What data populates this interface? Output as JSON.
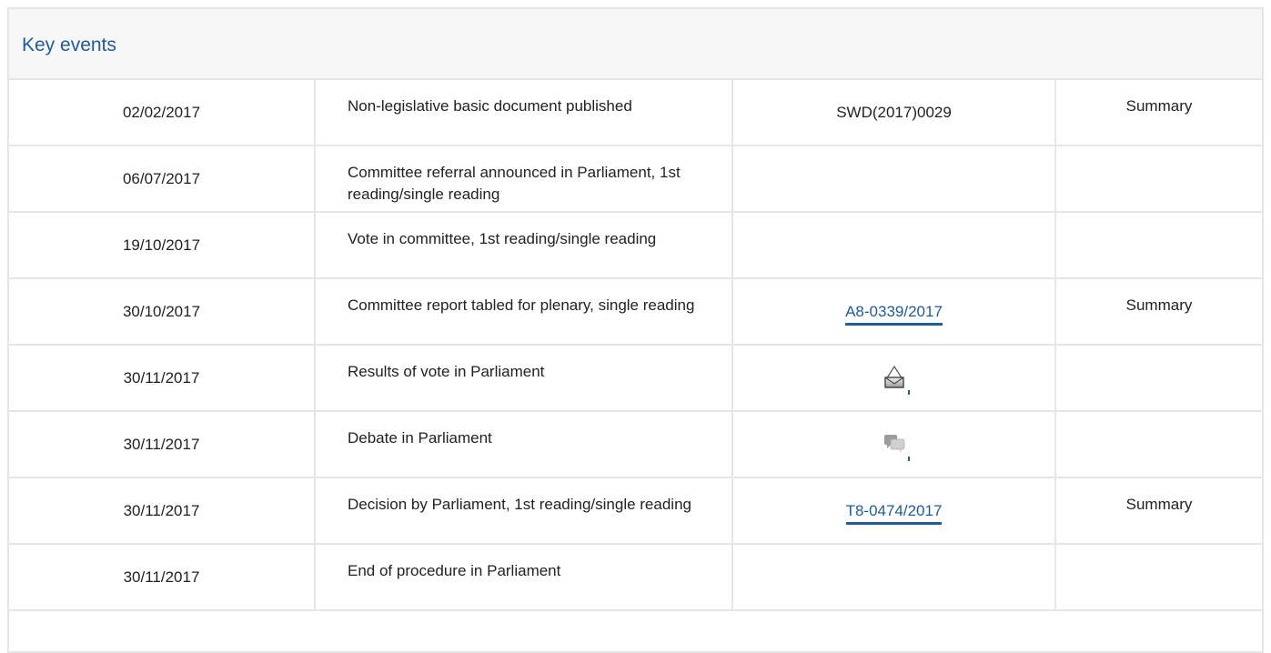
{
  "header": {
    "title": "Key events"
  },
  "rows": [
    {
      "date": "02/02/2017",
      "event": "Non-legislative basic document published",
      "doc": "SWD(2017)0029",
      "summary": "Summary"
    },
    {
      "date": "06/07/2017",
      "event": "Committee referral announced in Parliament, 1st reading/single reading",
      "doc": "",
      "summary": ""
    },
    {
      "date": "19/10/2017",
      "event": "Vote in committee, 1st reading/single reading",
      "doc": "",
      "summary": ""
    },
    {
      "date": "30/10/2017",
      "event": "Committee report tabled for plenary, single reading",
      "doc": "A8-0339/2017",
      "summary": "Summary"
    },
    {
      "date": "30/11/2017",
      "event": "Results of vote in Parliament",
      "doc_icon": "ballot-box-icon",
      "summary": ""
    },
    {
      "date": "30/11/2017",
      "event": "Debate in Parliament",
      "doc_icon": "speech-bubbles-icon",
      "summary": ""
    },
    {
      "date": "30/11/2017",
      "event": "Decision by Parliament, 1st reading/single reading",
      "doc": "T8-0474/2017",
      "summary": "Summary"
    },
    {
      "date": "30/11/2017",
      "event": "End of procedure in Parliament",
      "doc": "",
      "summary": ""
    }
  ],
  "colors": {
    "link": "#1f5c99",
    "border": "#e6e6e6",
    "header_bg": "#f7f7f7"
  }
}
